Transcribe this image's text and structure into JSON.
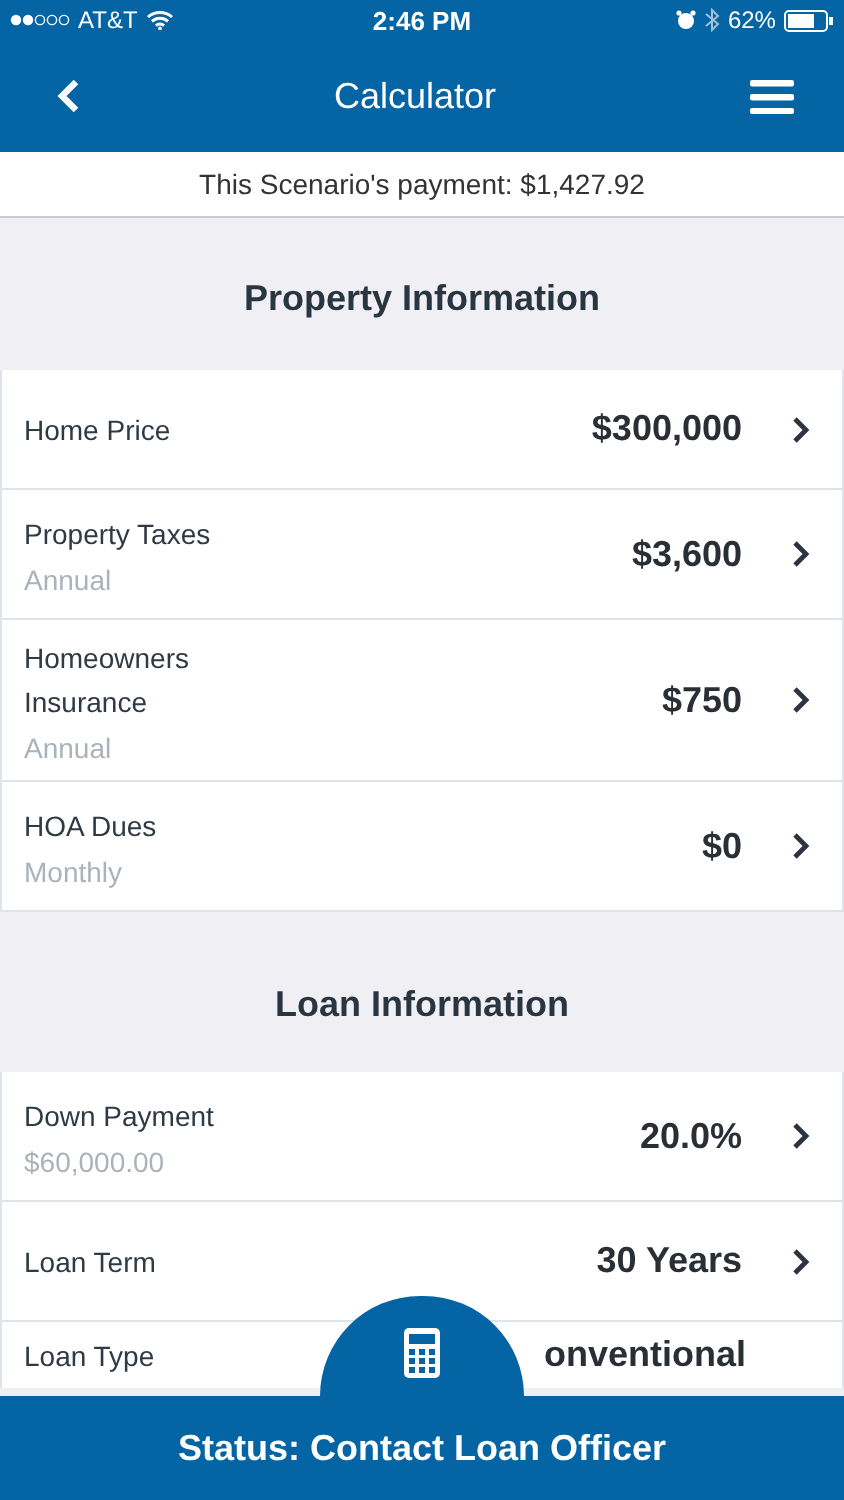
{
  "status_bar": {
    "carrier": "AT&T",
    "time": "2:46 PM",
    "battery": "62%"
  },
  "nav": {
    "title": "Calculator"
  },
  "payment": "This Scenario's payment: $1,427.92",
  "sections": [
    {
      "title": "Property Information",
      "rows": [
        {
          "label": "Home Price",
          "value": "$300,000"
        },
        {
          "label": "Property Taxes",
          "sub": "Annual",
          "value": "$3,600"
        },
        {
          "label": "Homeowners Insurance",
          "sub": "Annual",
          "value": "$750"
        },
        {
          "label": "HOA Dues",
          "sub": "Monthly",
          "value": "$0"
        }
      ]
    },
    {
      "title": "Loan Information",
      "rows": [
        {
          "label": "Down Payment",
          "sub": "$60,000.00",
          "value": "20.0%"
        },
        {
          "label": "Loan Term",
          "value": "30 Years"
        },
        {
          "label": "Loan Type",
          "value": "onventional",
          "cut": true
        }
      ]
    }
  ],
  "bottom": {
    "status": "Status: Contact Loan Officer"
  }
}
